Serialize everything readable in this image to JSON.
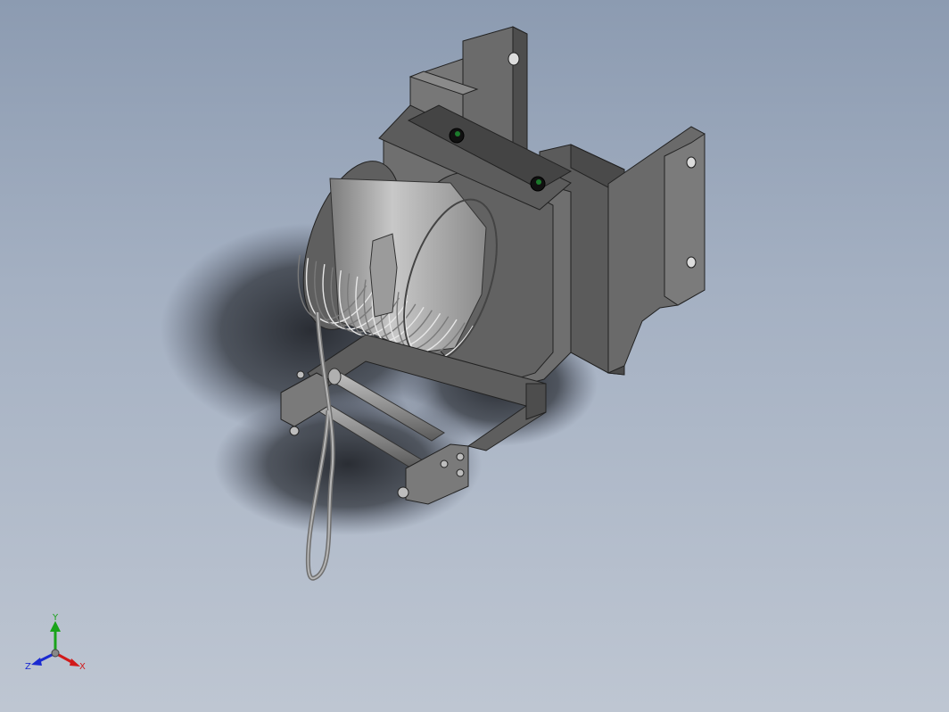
{
  "viewport": {
    "background_top": "#8c9bb1",
    "background_bottom": "#bec6d2"
  },
  "model": {
    "icon": "cable-winch-assembly",
    "colors": {
      "metal_light": "#8e8e8e",
      "metal_mid": "#6e6e6e",
      "metal_dark": "#4a4a4a",
      "drum": "#a8a8a8",
      "cable": "#9a9a9a",
      "shadow": "#2a2d33",
      "sensor": "#1c7a2c"
    }
  },
  "triad": {
    "x_label": "X",
    "y_label": "Y",
    "z_label": "Z",
    "x_color": "#d11a1a",
    "y_color": "#1aa31a",
    "z_color": "#1a2ad1"
  }
}
